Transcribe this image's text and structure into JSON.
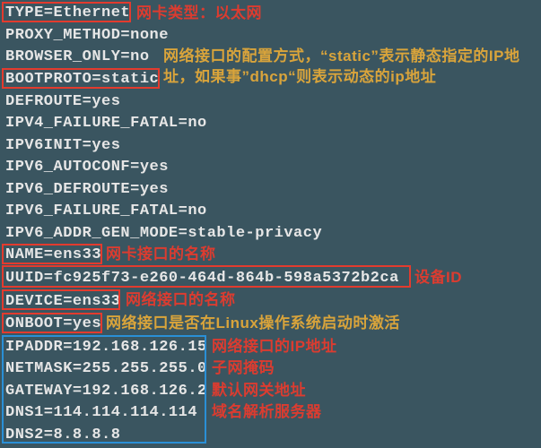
{
  "lines": {
    "l0": "TYPE=Ethernet",
    "l1": "PROXY_METHOD=none",
    "l2": "BROWSER_ONLY=no",
    "l3": "BOOTPROTO=static",
    "l4": "DEFROUTE=yes",
    "l5": "IPV4_FAILURE_FATAL=no",
    "l6": "IPV6INIT=yes",
    "l7": "IPV6_AUTOCONF=yes",
    "l8": "IPV6_DEFROUTE=yes",
    "l9": "IPV6_FAILURE_FATAL=no",
    "l10": "IPV6_ADDR_GEN_MODE=stable-privacy",
    "l11": "NAME=ens33",
    "l12": "UUID=fc925f73-e260-464d-864b-598a5372b2ca",
    "l13": "DEVICE=ens33",
    "l14": "ONBOOT=yes",
    "l15": "IPADDR=192.168.126.15",
    "l16": "NETMASK=255.255.255.0",
    "l17": "GATEWAY=192.168.126.2",
    "l18": "DNS1=114.114.114.114",
    "l19": "DNS2=8.8.8.8"
  },
  "ann": {
    "type": "网卡类型：以太网",
    "bootproto": "网络接口的配置方式，“static”表示静态指定的IP地址，如果事”dhcp“则表示动态的ip地址",
    "name": "网卡接口的名称",
    "uuid": "设备ID",
    "device": "网络接口的名称",
    "onboot": "网络接口是否在Linux操作系统启动时激活",
    "ipaddr": "网络接口的IP地址",
    "netmask": "子网掩码",
    "gateway": "默认网关地址",
    "dns": "域名解析服务器"
  }
}
